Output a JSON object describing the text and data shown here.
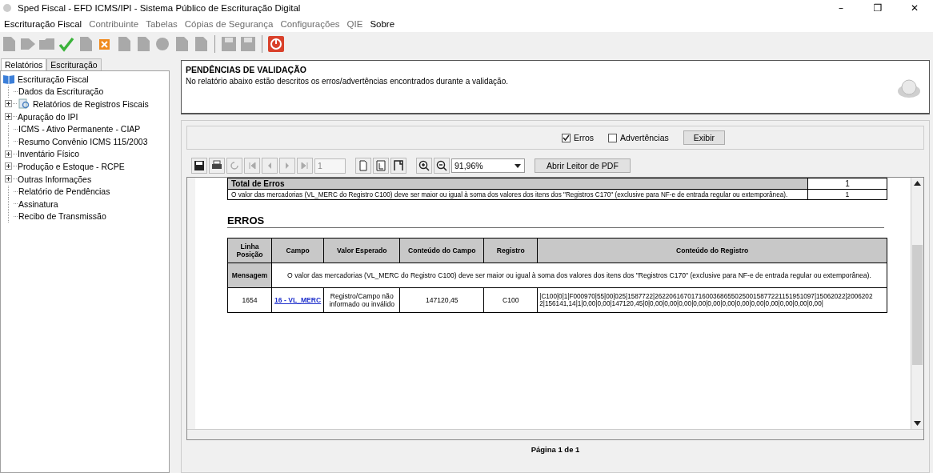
{
  "window": {
    "title": "Sped Fiscal - EFD ICMS/IPI - Sistema Público de Escrituração Digital",
    "controls": [
      "–",
      "❐",
      "✕"
    ]
  },
  "menu": [
    {
      "label": "Escrituração Fiscal",
      "disabled": false
    },
    {
      "label": "Contribuinte",
      "disabled": true
    },
    {
      "label": "Tabelas",
      "disabled": true
    },
    {
      "label": "Cópias de Segurança",
      "disabled": true
    },
    {
      "label": "Configurações",
      "disabled": true
    },
    {
      "label": "QIE",
      "disabled": true
    },
    {
      "label": "Sobre",
      "disabled": false
    }
  ],
  "sidebar": {
    "tabs": [
      {
        "label": "Relatórios",
        "selected": true
      },
      {
        "label": "Escrituração",
        "selected": false
      }
    ],
    "tree": {
      "label": "Escrituração Fiscal",
      "children": [
        {
          "label": "Dados da Escrituração",
          "expandable": false
        },
        {
          "label": "Relatórios de Registros Fiscais",
          "expandable": true,
          "kind": "report"
        },
        {
          "label": "Apuração do IPI",
          "expandable": true
        },
        {
          "label": "ICMS - Ativo Permanente - CIAP",
          "expandable": false
        },
        {
          "label": "Resumo  Convênio ICMS 115/2003",
          "expandable": false
        },
        {
          "label": "Inventário Físico",
          "expandable": true
        },
        {
          "label": "Produção e Estoque - RCPE",
          "expandable": true
        },
        {
          "label": "Outras Informações",
          "expandable": true
        },
        {
          "label": "Relatório de Pendências",
          "expandable": false
        },
        {
          "label": "Assinatura",
          "expandable": false
        },
        {
          "label": "Recibo de Transmissão",
          "expandable": false
        }
      ]
    }
  },
  "header": {
    "title": "PENDÊNCIAS DE VALIDAÇÃO",
    "description": "No relatório abaixo estão descritos os erros/advertências encontrados durante a validação."
  },
  "filters": {
    "checkboxes": [
      {
        "label": "Erros",
        "checked": true
      },
      {
        "label": "Advertências",
        "checked": false
      }
    ],
    "button": "Exibir"
  },
  "viewer_toolbar": {
    "page": "1",
    "zoom": "91,96%",
    "open_button": "Abrir Leitor de PDF"
  },
  "report": {
    "total_table": {
      "heading": "Total de Erros",
      "total": "1",
      "rows": [
        {
          "message": "O valor das mercadorias (VL_MERC do Registro C100) deve ser maior ou igual à soma dos valores dos itens dos \"Registros C170\" (exclusive para NF-e de entrada regular ou extemporânea).",
          "count": "1"
        }
      ]
    },
    "section_title": "ERROS",
    "errors_table": {
      "columns": [
        "Linha\nPosição",
        "Campo",
        "Valor Esperado",
        "Conteúdo do Campo",
        "Registro",
        "Conteúdo do Registro"
      ],
      "message_label": "Mensagem",
      "message": "O valor das mercadorias (VL_MERC do Registro C100) deve ser maior ou igual à soma dos valores dos itens dos \"Registros C170\" (exclusive para NF-e de entrada regular ou extemporânea).",
      "rows": [
        {
          "line": "1654",
          "field": "16 - VL_MERC",
          "expected": "Registro/Campo não informado ou inválido",
          "field_content": "147120,45",
          "record": "C100",
          "record_content": "|C100|0|1|F000970|55|00|025|1587722|26220616701716003686550250015877221151951097|15062022|2006202\n2|156141,14|1|0,00|0,00|147120,45|0|0,00|0,00|0,00|0,00|0,00|0,00|0,00|0,00|0,00|0,00|0,00|0,00|"
        }
      ]
    }
  },
  "page_label": "Página 1 de 1"
}
